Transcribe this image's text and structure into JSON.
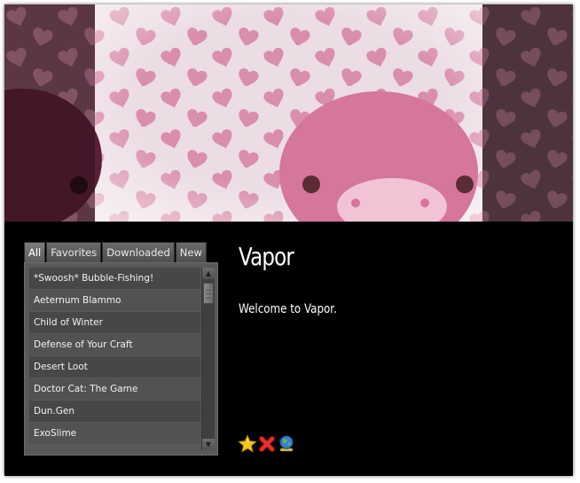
{
  "colors": {
    "background": "#000000",
    "banner_pink": "#e9d6df",
    "pig_pink": "#d77aa0",
    "heart_pink": "#d88aa8",
    "list_panel": "#595959",
    "text": "#ffffff"
  },
  "banner": {
    "icon": "pig-with-hearts-banner"
  },
  "tabs": [
    {
      "label": "All",
      "active": true
    },
    {
      "label": "Favorites",
      "active": false
    },
    {
      "label": "Downloaded",
      "active": false
    },
    {
      "label": "New",
      "active": false
    }
  ],
  "games": [
    "*Swoosh* Bubble-Fishing!",
    "Aeternum Blammo",
    "Child of Winter",
    "Defense of Your Craft",
    "Desert Loot",
    "Doctor Cat: The Game",
    "Dun.Gen",
    "ExoSlime"
  ],
  "detail": {
    "title": "Vapor",
    "description": "Welcome to Vapor."
  },
  "actions": [
    {
      "name": "favorite",
      "icon": "star-icon"
    },
    {
      "name": "delete",
      "icon": "red-x-icon"
    },
    {
      "name": "update",
      "icon": "globe-download-icon"
    }
  ]
}
